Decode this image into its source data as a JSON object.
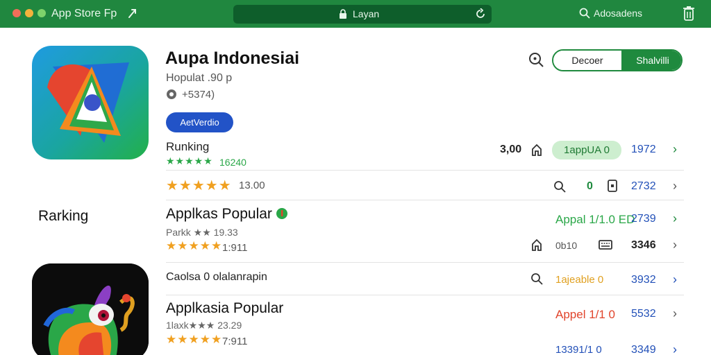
{
  "window": {
    "title": "App Store Fp",
    "url_text": "Layan",
    "search_label": "Adosadens"
  },
  "header": {
    "app_name": "Aupa Indonesiai",
    "subtitle": "Hopulat .90 p",
    "size": "+5374)",
    "version_button": "AetVerdio",
    "seg_left": "Decoer",
    "seg_right": "Shalvilli"
  },
  "sidebar": {
    "label": "Rarking"
  },
  "rows": [
    {
      "title": "Runking",
      "stars": "★★★★★",
      "rating_count": "16240",
      "price": "3,00",
      "pill": "1appUA 0",
      "number": "1972"
    },
    {
      "stars": "★★★★★",
      "rating_count": "13.00",
      "mid": "0",
      "number": "2732"
    },
    {
      "title": "Applkas Popular",
      "sub": "Parkk ★★ 19.33",
      "stars": "★★★★★",
      "rating_count": "1:911",
      "tag": "Appal 1/1.0 ED",
      "number": "2739"
    },
    {
      "mid_text": "0b10",
      "number": "3346"
    },
    {
      "title": "Caolsa 0 olalanrapin",
      "tag": "1ajeable 0",
      "number": "3932"
    },
    {
      "title": "Applkasia Popular",
      "sub": "1laxk★★★ 23.29",
      "stars": "★★★★★",
      "rating_count": "7:911",
      "tag": "Appel 1/1 0",
      "number": "5532"
    },
    {
      "tag": "13391/1 0",
      "number": "3349"
    }
  ],
  "colors": {
    "brand_green": "#20873f",
    "accent_blue": "#2253c7",
    "star_orange": "#f0a020",
    "star_green": "#2aa748",
    "tag_red": "#e1442b",
    "tag_orange": "#e0a020"
  }
}
